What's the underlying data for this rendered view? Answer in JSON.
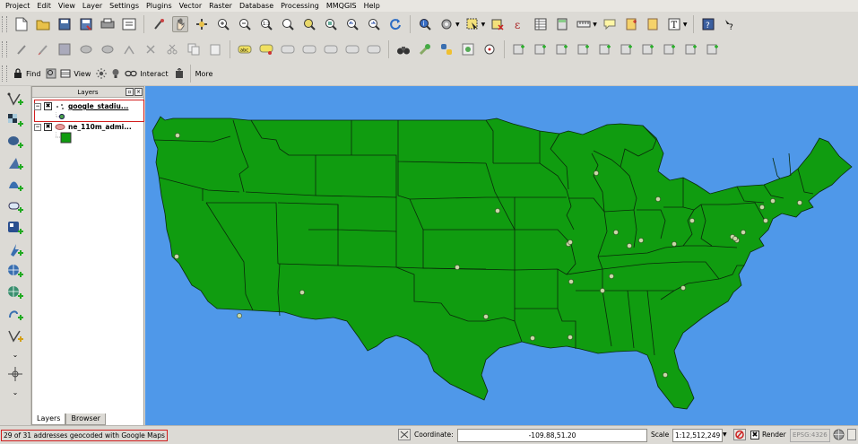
{
  "menu": [
    "Project",
    "Edit",
    "View",
    "Layer",
    "Settings",
    "Plugins",
    "Vector",
    "Raster",
    "Database",
    "Processing",
    "MMQGIS",
    "Help"
  ],
  "toolbar3": {
    "find_label": "Find",
    "view_label": "View",
    "interact_label": "Interact",
    "more_label": "More"
  },
  "layers_panel": {
    "title": "Layers",
    "layers": [
      {
        "name": "google_stadiu...",
        "checked_mark": "✖"
      },
      {
        "name": "ne_110m_admi...",
        "checked_mark": "✖"
      }
    ],
    "tab_layers": "Layers",
    "tab_browser": "Browser"
  },
  "status": {
    "message": "29 of 31 addresses geocoded with Google Maps",
    "coordinate_label": "Coordinate:",
    "coordinate_value": "-109.88,51.20",
    "scale_label": "Scale",
    "scale_value": "1:12,512,249",
    "render_label": "Render",
    "render_mark": "✖",
    "epsg": "EPSG:4326"
  },
  "colors": {
    "map_background": "#4f98e9",
    "state_fill": "#109c10",
    "point_fill": "#c8d8a8",
    "accent": "#d21f1f"
  }
}
